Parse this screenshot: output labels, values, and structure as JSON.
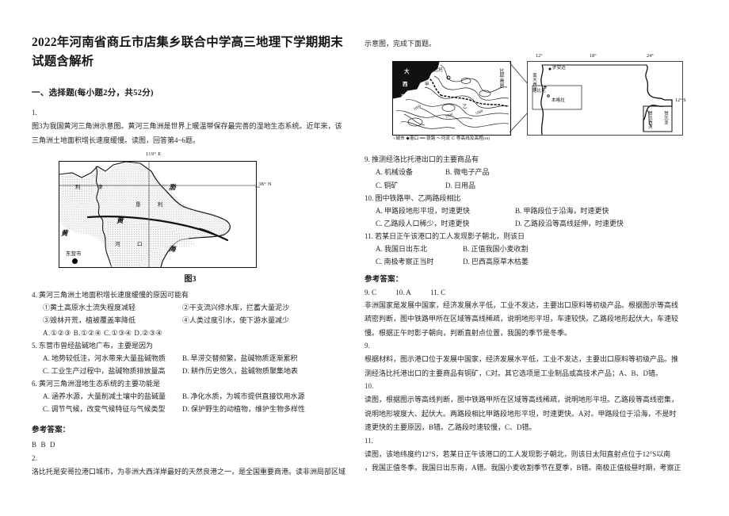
{
  "document": {
    "title": "2022年河南省商丘市店集乡联合中学高三地理下学期期末试题含解析",
    "section_heading": "一、选择题(每小题2分，共52分)"
  },
  "left_column": {
    "item1": {
      "number": "1.",
      "stem_line1": "图3为我国黄河三角洲示意图。黄河三角洲是世界上暖温带保存最完善的湿地生态系统。近年来，该",
      "stem_line2": "三角洲土地面积增长速度缓慢。读图，回答第4~6题。"
    },
    "figure3": {
      "caption": "图3",
      "lon_label": "119° E",
      "lat_label": "38° N",
      "labels": [
        "渤",
        "海",
        "黄",
        "海",
        "东营市",
        "垦",
        "利",
        "河",
        "口",
        "利",
        "津",
        "黄",
        "河"
      ],
      "city": "东营市"
    },
    "q4": {
      "stem": "4. 黄河三角洲土地面积增长速度缓慢的原因可能有",
      "sub1": "①黄土高原水土流失程度减轻",
      "sub2": "②干支流兴修水库，拦蓄大量泥沙",
      "sub3": "③毁林开荒，植被覆盖率降低",
      "sub4": "④人类过度引水，使下游水量减少",
      "options": "A.①②③   B.①②④   C.①③④   D.②③④"
    },
    "q5": {
      "stem": "5. 东营市曾经盐碱地广布，主要是因为",
      "A": "A. 地势较低洼，河水带来大量盐碱物质",
      "B": "B. 旱涝交替频繁，盐碱物质逐渐累积",
      "C": "C. 工业生产过程中，盐碱物质排放量高",
      "D": "D. 耕作历史悠久，盐碱物质聚集地表"
    },
    "q6": {
      "stem": "6. 黄河三角洲湿地生态系统的主要功能是",
      "A": "A. 涵养水源，大量削减土壤中的盐碱量",
      "B": "B. 净化水质，为城市提供直接饮用水源",
      "C": "C. 调节气候，改变气候特征与气候类型",
      "D": "D. 保护野生的动植物，维护生物多样性"
    },
    "answers_heading": "参考答案：",
    "answers": "B B D",
    "item2": {
      "number": "2.",
      "stem": "洛比托是安哥拉港口城市，为非洲大西洋岸最好的天然良港之一，是全国重要商港。读非洲局部区域"
    }
  },
  "right_column": {
    "stem_continuation": "示意图，完成下面题。",
    "figure_angola": {
      "detail_labels": [
        "大",
        "西",
        "洋",
        "洛比托",
        "甲",
        "乙",
        "比",
        "耶",
        "高",
        "原",
        "1000",
        "1500",
        "1000"
      ],
      "legend": "○城市  ◆港口  ━━ 铁路  〜河流  ⊂ 等高线及高程(m)",
      "overview_ticks": [
        "12°",
        "18°",
        "24°"
      ],
      "lat_tick": "12° S",
      "overview_labels": [
        "罗安达",
        "南大西洋",
        "洛比托",
        "本格拉",
        "赞比西河",
        "赞比亚"
      ]
    },
    "q9": {
      "stem": "9.  推测经洛比托港出口的主要商品有",
      "A": "A.  机械设备",
      "B": "B.  微电子产品",
      "C": "C.  铜矿",
      "D": "D.  日用品"
    },
    "q10": {
      "stem": "10.  图中铁路甲、乙两路段相比",
      "A": "A.  甲路段地形平坦，时速更快",
      "B": "B.  甲路段位于沿海，时速更快",
      "C": "C.  乙路段人口稀少，时速更快",
      "D": "D.  乙路段沿等高线延伸，时速更快"
    },
    "q11": {
      "stem": "11.  若某日正午该港口的工人发现影子朝北，则该日",
      "A": "A.  我国日出东北",
      "B": "B.  正值我国小麦收割",
      "C": "C.  南极考察正当时",
      "D": "D.  巴西高原草木枯萎"
    },
    "answers_heading": "参考答案：",
    "answer_key": [
      "9. C",
      "10. A",
      "11. C"
    ],
    "overall_explanation_l1": "非洲国家是发展中国家，经济发展水平低，工业不发达，主要出口原料等初级产品。根据图示等高线",
    "overall_explanation_l2": "疏密判断，图中铁路甲所在区域等高线稀疏，说明地形平坦，车速较快。乙路段地形起伏大，车速较",
    "overall_explanation_l3": "慢。根据正午时影子朝向，判断直射点位置，我国的季节是冬季。",
    "exp9_num": "9.",
    "exp9_l1": "根据材料，图示港口位于发展中国家，经济发展水平低，工业不发达，主要出口原料等初级产品。推",
    "exp9_l2": "测经洛比托港出口的主要商品有铜矿，C对。其它选项是工业制品或高技术产品；A、B、D错。",
    "exp10_num": "10.",
    "exp10_l1": "读图，根据图示等高线判断，图中铁路甲所在区域等高线稀疏，说明地形平坦。乙路段等高线密集，",
    "exp10_l2": "说明地形坡度大、起伏大。两路段相比甲路段地形平坦，时速更快。A对。甲路段位于沿海，不是时",
    "exp10_l3": "速更快的主要原因，B错。乙路段时速较慢，C、D错。",
    "exp11_num": "11.",
    "exp11_l1": "读图，该地纬度约12°S，若某日正午该港口的工人发现影子朝北，则该日太阳直射点位于12°S以南",
    "exp11_l2": "，我国正值冬季。我国日出东南，A错。我国小麦收割季节在夏季，B错。南极正值极昼时期，考察正"
  }
}
